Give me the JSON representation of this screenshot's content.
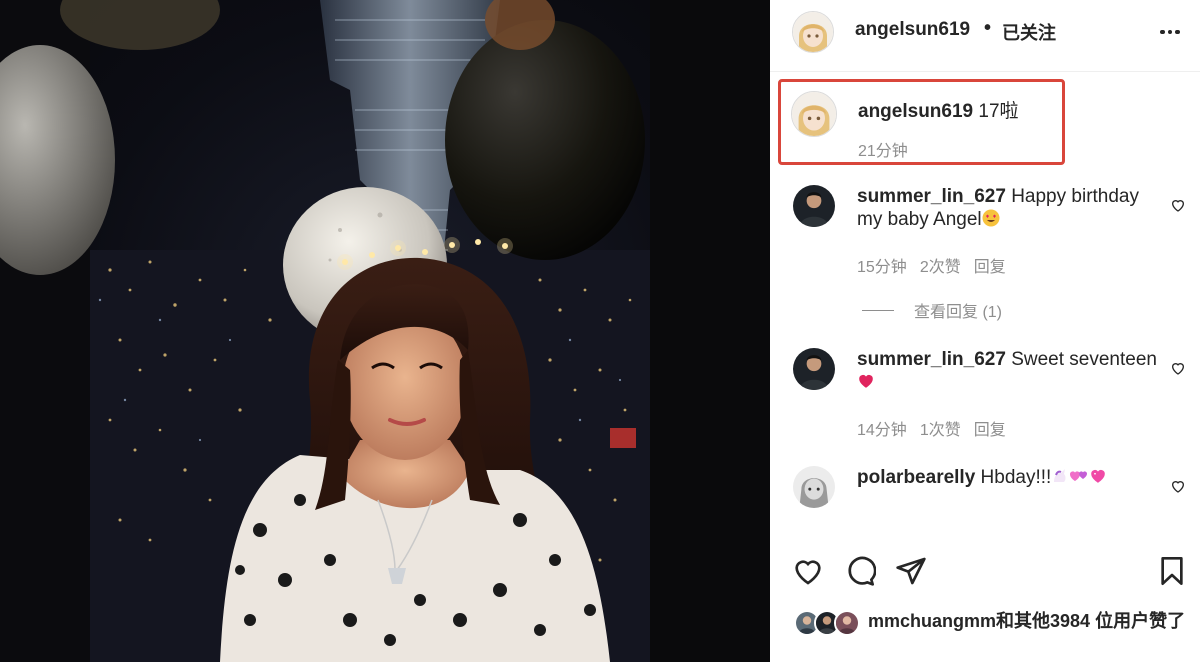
{
  "post": {
    "author": "angelsun619",
    "separator": "•",
    "follow_status": "已关注"
  },
  "caption": {
    "user": "angelsun619",
    "text": " 17啦",
    "time": "21分钟"
  },
  "comments": [
    {
      "user": "summer_lin_627",
      "text": " Happy birthday my baby Angel",
      "emoji": "heart-eyes",
      "time": "15分钟",
      "likes": "2次赞",
      "reply": "回复"
    },
    {
      "user": "summer_lin_627",
      "text": " Sweet seventeen ",
      "emoji": "red-heart",
      "time": "14分钟",
      "likes": "1次赞",
      "reply": "回复"
    },
    {
      "user": "polarbearelly",
      "text": " Hbday!!!",
      "emoji": "unicorn-hearts"
    }
  ],
  "view_replies": "查看回复 (1)",
  "likes": {
    "text": "mmchuangmm和其他3984 位用户赞了"
  },
  "colors": {
    "highlight_border": "#d9463b",
    "muted_text": "#8e8e8e",
    "primary_text": "#262626"
  }
}
